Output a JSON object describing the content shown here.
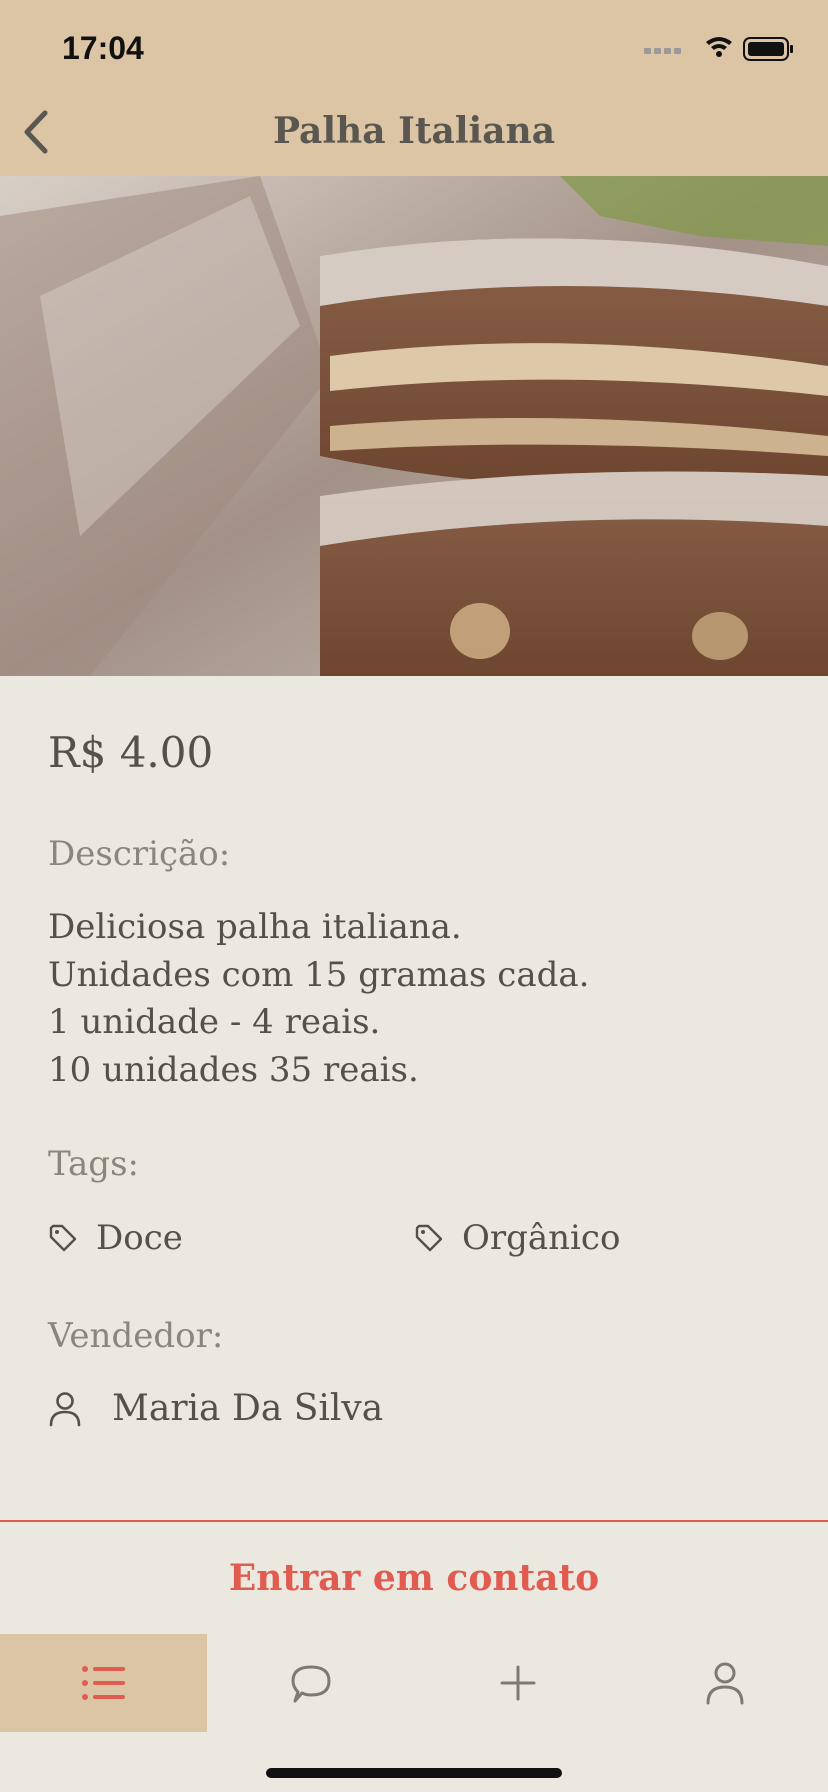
{
  "status_bar": {
    "time": "17:04"
  },
  "nav": {
    "title": "Palha Italiana"
  },
  "product": {
    "price": "R$ 4.00",
    "description_label": "Descrição:",
    "description_lines": [
      "Deliciosa palha italiana.",
      "Unidades com 15 gramas cada.",
      "1 unidade - 4 reais.",
      "10 unidades 35 reais."
    ],
    "tags_label": "Tags:",
    "tags": [
      "Doce",
      "Orgânico"
    ],
    "seller_label": "Vendedor:",
    "seller_name": "Maria Da Silva"
  },
  "contact": {
    "label": "Entrar em contato"
  },
  "tabs": [
    {
      "icon": "list-icon",
      "active": true
    },
    {
      "icon": "chat-bubble-icon",
      "active": false
    },
    {
      "icon": "plus-icon",
      "active": false
    },
    {
      "icon": "user-icon",
      "active": false
    }
  ],
  "colors": {
    "accent": "#e25b50",
    "header": "#dcc5a5",
    "background": "#ebe8df"
  }
}
